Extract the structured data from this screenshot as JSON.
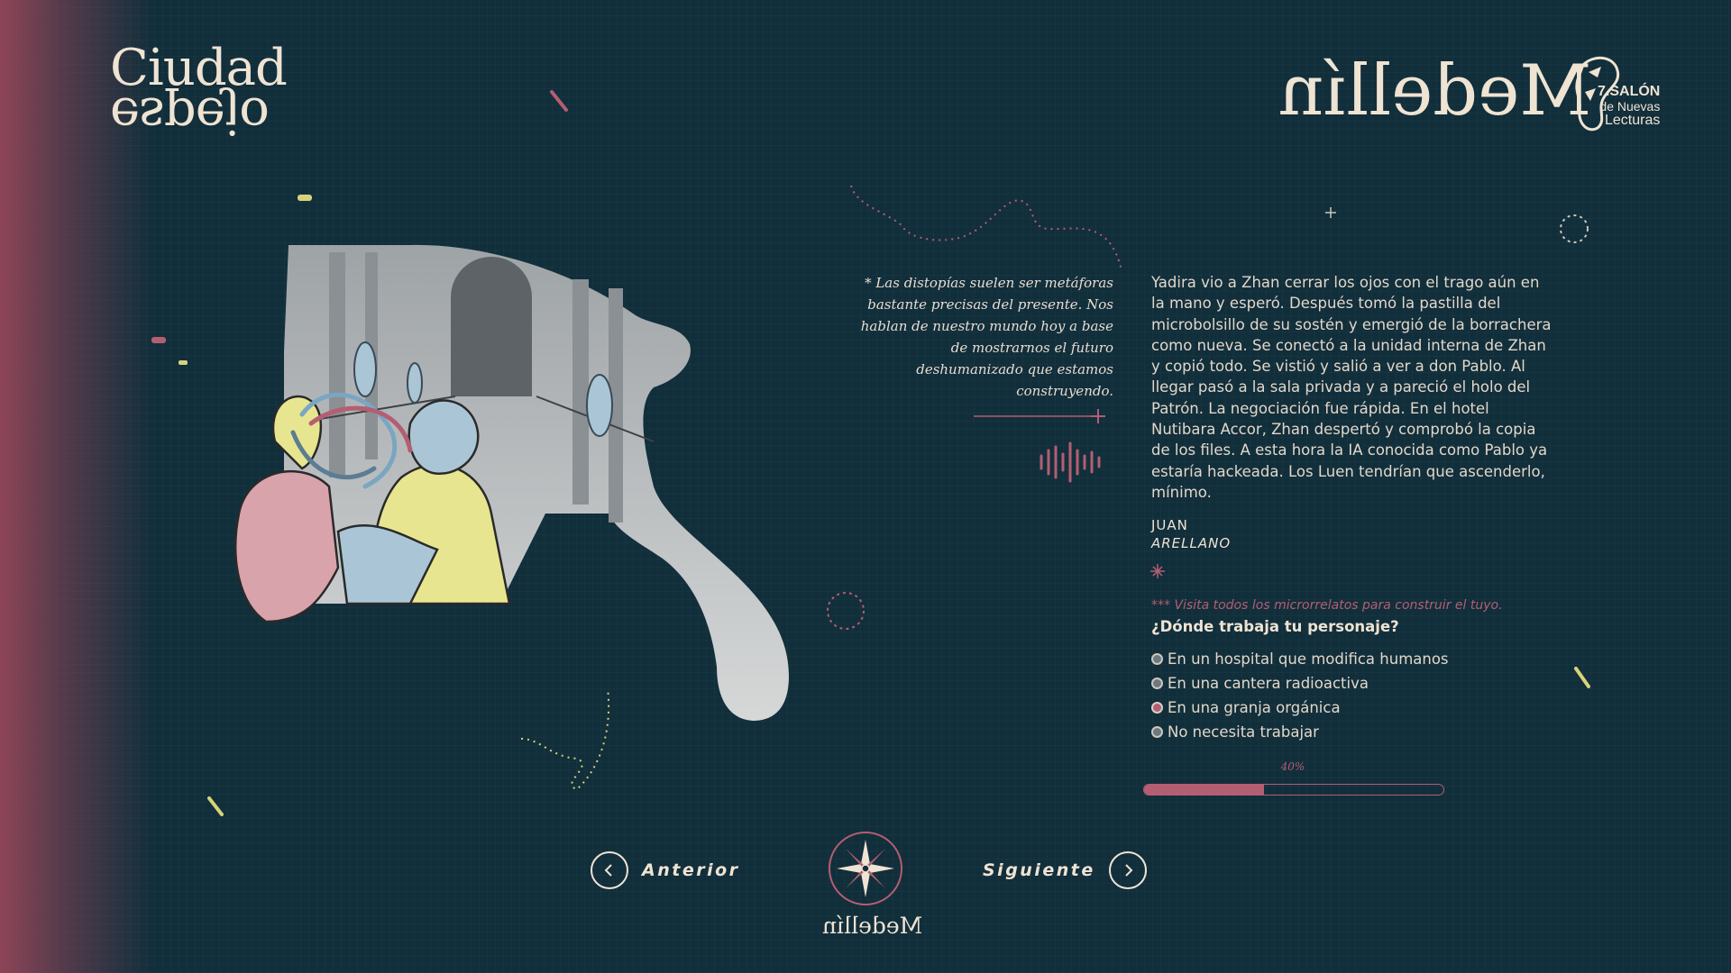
{
  "branding": {
    "ciudad_line1": "Ciudad",
    "ciudad_line2": "espejo",
    "medellin": "Medellín",
    "salon_line1": "7.SALÓN",
    "salon_line2": "de Nuevas",
    "salon_line3": "Lecturas"
  },
  "quote": "* Las distopías suelen ser metáforas bastante precisas del presente. Nos hablan de nuestro mundo hoy a base de mostrarnos el futuro deshumanizado que estamos construyendo.",
  "story": {
    "text": "Yadira vio a Zhan cerrar los ojos con el trago aún en la mano y esperó. Después tomó la pastilla del microbolsillo de su sostén y emergió de la borrachera como nueva. Se conectó a la unidad interna de Zhan y copió todo. Se vistió y salió a ver a don Pablo. Al llegar pasó a la sala privada y a pareció el holo del Patrón. La negociación fue rápida. En el hotel Nutibara Accor, Zhan despertó y comprobó la copia de los files. A esta hora la IA conocida como Pablo ya estaría hackeada. Los Luen tendrían que ascenderlo, mínimo.",
    "author_first": "JUAN",
    "author_last": "ARELLANO"
  },
  "quiz": {
    "hint": "*** Visita todos los microrrelatos para construir el tuyo.",
    "question": "¿Dónde trabaja tu personaje?",
    "options": [
      {
        "label": "En un hospital que modifica humanos",
        "selected": false
      },
      {
        "label": "En una cantera radioactiva",
        "selected": false
      },
      {
        "label": "En una granja orgánica",
        "selected": true
      },
      {
        "label": "No necesita trabajar",
        "selected": false
      }
    ]
  },
  "progress": {
    "label": "40%",
    "value": 0.4
  },
  "navigation": {
    "prev_label": "Anterior",
    "next_label": "Siguiente",
    "footer_logo": "Medellín"
  },
  "colors": {
    "background": "#112e3b",
    "accent": "#b45e72",
    "text": "#e8ddd0",
    "highlight": "#d8d27a"
  }
}
